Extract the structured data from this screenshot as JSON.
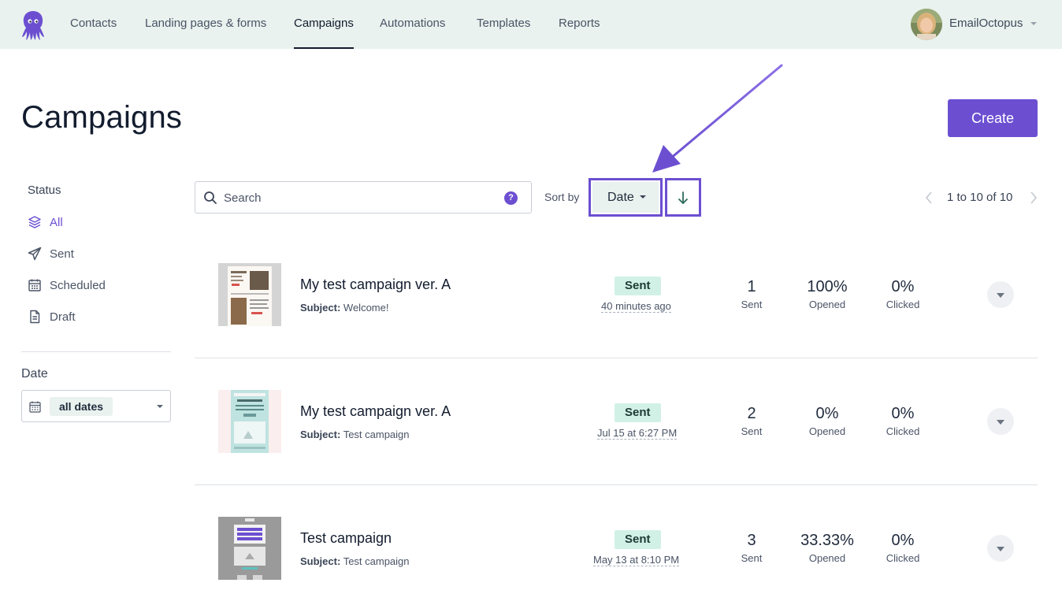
{
  "nav": {
    "items": [
      {
        "label": "Contacts"
      },
      {
        "label": "Landing pages & forms"
      },
      {
        "label": "Campaigns"
      },
      {
        "label": "Automations"
      },
      {
        "label": "Templates"
      },
      {
        "label": "Reports"
      }
    ],
    "active": "Campaigns",
    "account_name": "EmailOctopus"
  },
  "page": {
    "title": "Campaigns",
    "create_label": "Create"
  },
  "sidebar": {
    "status_heading": "Status",
    "status_items": [
      {
        "label": "All",
        "icon": "layers-icon",
        "active": true
      },
      {
        "label": "Sent",
        "icon": "paper-plane-icon"
      },
      {
        "label": "Scheduled",
        "icon": "calendar-icon"
      },
      {
        "label": "Draft",
        "icon": "document-icon"
      }
    ],
    "date_heading": "Date",
    "date_value": "all dates"
  },
  "toolbar": {
    "search_placeholder": "Search",
    "help_glyph": "?",
    "sort_label": "Sort by",
    "sort_value": "Date",
    "sort_direction": "descending",
    "pagination": "1 to 10 of 10"
  },
  "campaigns": [
    {
      "name": "My test campaign ver. A",
      "subject_label": "Subject:",
      "subject": "Welcome!",
      "status": "Sent",
      "time": "40 minutes ago",
      "sent": {
        "value": "1",
        "label": "Sent"
      },
      "opened": {
        "value": "100%",
        "label": "Opened"
      },
      "clicked": {
        "value": "0%",
        "label": "Clicked"
      }
    },
    {
      "name": "My test campaign ver. A",
      "subject_label": "Subject:",
      "subject": "Test campaign",
      "status": "Sent",
      "time": "Jul 15 at 6:27 PM",
      "sent": {
        "value": "2",
        "label": "Sent"
      },
      "opened": {
        "value": "0%",
        "label": "Opened"
      },
      "clicked": {
        "value": "0%",
        "label": "Clicked"
      }
    },
    {
      "name": "Test campaign",
      "subject_label": "Subject:",
      "subject": "Test campaign",
      "status": "Sent",
      "time": "May 13 at 8:10 PM",
      "sent": {
        "value": "3",
        "label": "Sent"
      },
      "opened": {
        "value": "33.33%",
        "label": "Opened"
      },
      "clicked": {
        "value": "0%",
        "label": "Clicked"
      }
    }
  ],
  "colors": {
    "brand": "#6c4fd1",
    "nav_bg": "#e9f2ee",
    "sent_badge_bg": "#d2f1e6",
    "text": "#121c2e"
  }
}
